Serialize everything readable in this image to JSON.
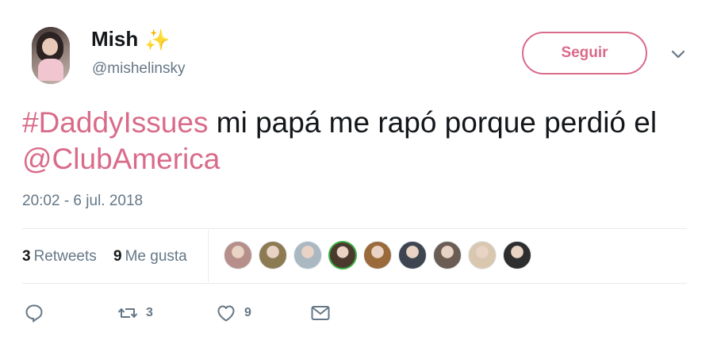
{
  "user": {
    "display_name": "Mish",
    "emoji": "✨",
    "handle": "@mishelinsky",
    "avatar_icon": "user-avatar"
  },
  "follow_label": "Seguir",
  "tweet": {
    "hashtag": "#DaddyIssues",
    "text_1": " mi papá me rapó porque perdió el ",
    "mention": "@ClubAmerica"
  },
  "timestamp": "20:02 - 6 jul. 2018",
  "stats": {
    "retweets_count": "3",
    "retweets_label": "Retweets",
    "likes_count": "9",
    "likes_label": "Me gusta"
  },
  "likers": [
    {
      "name": "liker-avatar-1",
      "color": "#b78f8a"
    },
    {
      "name": "liker-avatar-2",
      "color": "#8c7a52"
    },
    {
      "name": "liker-avatar-3",
      "color": "#aab8c2"
    },
    {
      "name": "liker-avatar-4",
      "color": "#4a3a2e"
    },
    {
      "name": "liker-avatar-5",
      "color": "#9a6a3a"
    },
    {
      "name": "liker-avatar-6",
      "color": "#3e4550"
    },
    {
      "name": "liker-avatar-7",
      "color": "#6b5d54"
    },
    {
      "name": "liker-avatar-8",
      "color": "#d9c7b0"
    },
    {
      "name": "liker-avatar-9",
      "color": "#2e2e2e"
    }
  ],
  "actions": {
    "reply_icon": "reply-icon",
    "retweet_icon": "retweet-icon",
    "retweet_count": "3",
    "like_icon": "heart-icon",
    "like_count": "9",
    "dm_icon": "envelope-icon"
  },
  "colors": {
    "accent": "#d96b8a",
    "text": "#14171a",
    "secondary": "#657786",
    "divider": "#e6ecf0"
  }
}
